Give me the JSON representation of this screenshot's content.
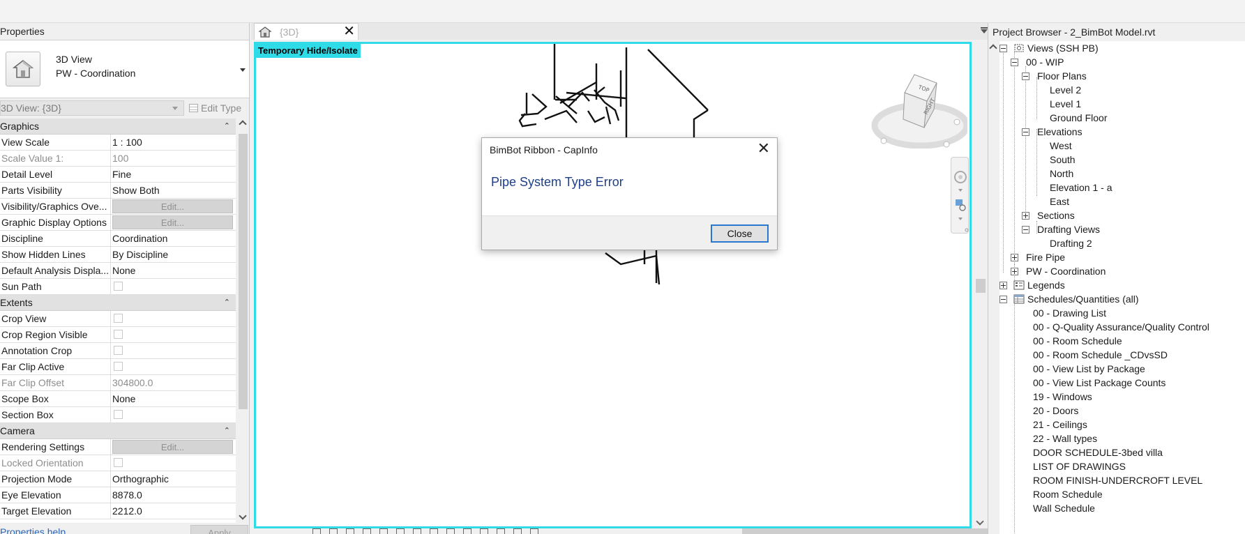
{
  "properties": {
    "title": "Properties",
    "type_name": "3D View",
    "type_subname": "PW - Coordination",
    "instance_selector": "3D View: {3D}",
    "edit_type": "Edit Type",
    "help_link": "Properties help",
    "apply_button": "Apply",
    "sections": {
      "graphics": "Graphics",
      "extents": "Extents",
      "camera": "Camera"
    },
    "rows": {
      "view_scale": {
        "name": "View Scale",
        "value": "1 : 100"
      },
      "scale_value": {
        "name": "Scale Value    1:",
        "value": "100"
      },
      "detail_level": {
        "name": "Detail Level",
        "value": "Fine"
      },
      "parts_visibility": {
        "name": "Parts Visibility",
        "value": "Show Both"
      },
      "vg_overrides": {
        "name": "Visibility/Graphics Ove...",
        "value": "Edit..."
      },
      "graphic_display": {
        "name": "Graphic Display Options",
        "value": "Edit..."
      },
      "discipline": {
        "name": "Discipline",
        "value": "Coordination"
      },
      "hidden_lines": {
        "name": "Show Hidden Lines",
        "value": "By Discipline"
      },
      "analysis_display": {
        "name": "Default Analysis Displa...",
        "value": "None"
      },
      "sun_path": {
        "name": "Sun Path"
      },
      "crop_view": {
        "name": "Crop View"
      },
      "crop_region_visible": {
        "name": "Crop Region Visible"
      },
      "annotation_crop": {
        "name": "Annotation Crop"
      },
      "far_clip_active": {
        "name": "Far Clip Active"
      },
      "far_clip_offset": {
        "name": "Far Clip Offset",
        "value": "304800.0"
      },
      "scope_box": {
        "name": "Scope Box",
        "value": "None"
      },
      "section_box": {
        "name": "Section Box"
      },
      "rendering_settings": {
        "name": "Rendering Settings",
        "value": "Edit..."
      },
      "locked_orientation": {
        "name": "Locked Orientation"
      },
      "projection_mode": {
        "name": "Projection Mode",
        "value": "Orthographic"
      },
      "eye_elevation": {
        "name": "Eye Elevation",
        "value": "8878.0"
      },
      "target_elevation": {
        "name": "Target Elevation",
        "value": "2212.0"
      }
    }
  },
  "view": {
    "tab_label": "{3D}",
    "banner": "Temporary Hide/Isolate",
    "viewcube": {
      "top": "TOP",
      "right": "RIGHT"
    }
  },
  "dialog": {
    "title": "BimBot Ribbon - CapInfo",
    "message": "Pipe System Type Error",
    "close_button": "Close"
  },
  "browser": {
    "title": "Project Browser - 2_BimBot Model.rvt",
    "nodes": {
      "views_root": "Views (SSH PB)",
      "wip": "00 - WIP",
      "floor_plans": "Floor Plans",
      "level2": "Level 2",
      "level1": "Level 1",
      "ground_floor": "Ground Floor",
      "elevations": "Elevations",
      "west": "West",
      "south": "South",
      "north": "North",
      "elevation1a": "Elevation 1 - a",
      "east": "East",
      "sections": "Sections",
      "drafting_views": "Drafting Views",
      "drafting2": "Drafting 2",
      "fire_pipe": "Fire Pipe",
      "pw_coordination": "PW - Coordination",
      "legends": "Legends",
      "schedules": "Schedules/Quantities (all)",
      "s_drawing_list": "00 - Drawing List",
      "s_qaqc": "00 - Q-Quality Assurance/Quality Control",
      "s_room_schedule": "00 - Room Schedule",
      "s_room_schedule_cd": "00 - Room Schedule _CDvsSD",
      "s_view_list_pkg": "00 - View List by Package",
      "s_view_list_counts": "00 - View List Package Counts",
      "s_windows": "19 - Windows",
      "s_doors": "20 - Doors",
      "s_ceilings": "21 - Ceilings",
      "s_wall_types": "22 - Wall types",
      "s_door_schedule": "DOOR SCHEDULE-3bed villa",
      "s_list_drawings": "LIST OF DRAWINGS",
      "s_room_finish": "ROOM FINISH-UNDERCROFT LEVEL",
      "s_room_sched": "Room Schedule",
      "s_wall_sched": "Wall Schedule"
    }
  }
}
